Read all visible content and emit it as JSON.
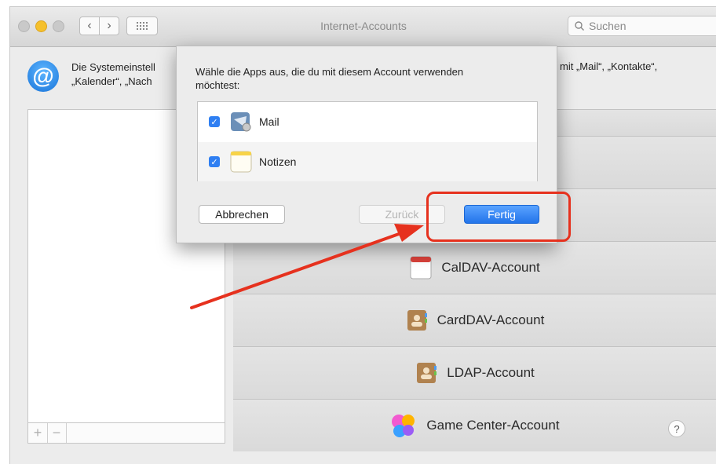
{
  "window": {
    "title": "Internet-Accounts"
  },
  "search": {
    "placeholder": "Suchen"
  },
  "description": {
    "line1": "Die Systemeinstell",
    "line2": "„Kalender“, „Nach",
    "right_line1": "mit „Mail“, „Kontakte“,"
  },
  "sheet": {
    "prompt": "Wähle die Apps aus, die du mit diesem Account verwenden möchtest:",
    "apps": [
      {
        "label": "Mail",
        "checked": true,
        "icon": "mail-app-icon"
      },
      {
        "label": "Notizen",
        "checked": true,
        "icon": "notes-app-icon"
      }
    ],
    "cancel_label": "Abbrechen",
    "back_label": "Zurück",
    "done_label": "Fertig"
  },
  "accounts": [
    {
      "label": "CalDAV-Account",
      "icon": "calendar-icon"
    },
    {
      "label": "CardDAV-Account",
      "icon": "contacts-book-icon"
    },
    {
      "label": "LDAP-Account",
      "icon": "contacts-book-icon"
    },
    {
      "label": "Game Center-Account",
      "icon": "game-center-icon"
    }
  ],
  "list_buttons": {
    "add": "+",
    "remove": "−"
  },
  "help_label": "?",
  "colors": {
    "accent": "#2374ea",
    "callout": "#e6311e",
    "traffic_yellow": "#f5c02c"
  }
}
